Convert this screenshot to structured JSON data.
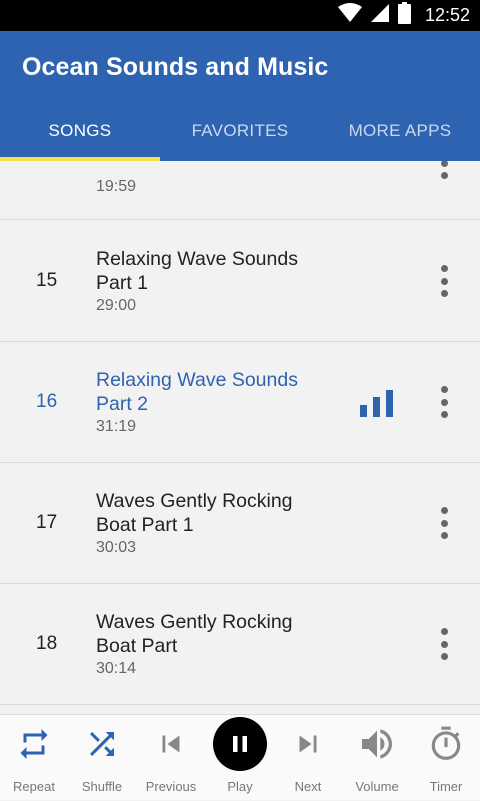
{
  "status": {
    "time": "12:52"
  },
  "app": {
    "title": "Ocean Sounds and Music"
  },
  "tabs": [
    {
      "label": "SONGS",
      "active": true
    },
    {
      "label": "FAVORITES",
      "active": false
    },
    {
      "label": "MORE APPS",
      "active": false
    }
  ],
  "list": {
    "partial": {
      "duration": "19:59"
    },
    "rows": [
      {
        "number": "15",
        "title": "Relaxing Wave Sounds Part 1",
        "duration": "29:00",
        "playing": false
      },
      {
        "number": "16",
        "title": "Relaxing Wave Sounds Part 2",
        "duration": "31:19",
        "playing": true
      },
      {
        "number": "17",
        "title": "Waves Gently Rocking Boat Part 1",
        "duration": "30:03",
        "playing": false
      },
      {
        "number": "18",
        "title": "Waves Gently Rocking Boat Part",
        "duration": "30:14",
        "playing": false
      }
    ]
  },
  "player": {
    "repeat": "Repeat",
    "shuffle": "Shuffle",
    "previous": "Previous",
    "play": "Play",
    "next": "Next",
    "volume": "Volume",
    "timer": "Timer"
  },
  "colors": {
    "primary": "#2e63b2",
    "tab_indicator": "#f4e24a",
    "active_control": "#2e63b2",
    "inactive_control": "#888888"
  }
}
